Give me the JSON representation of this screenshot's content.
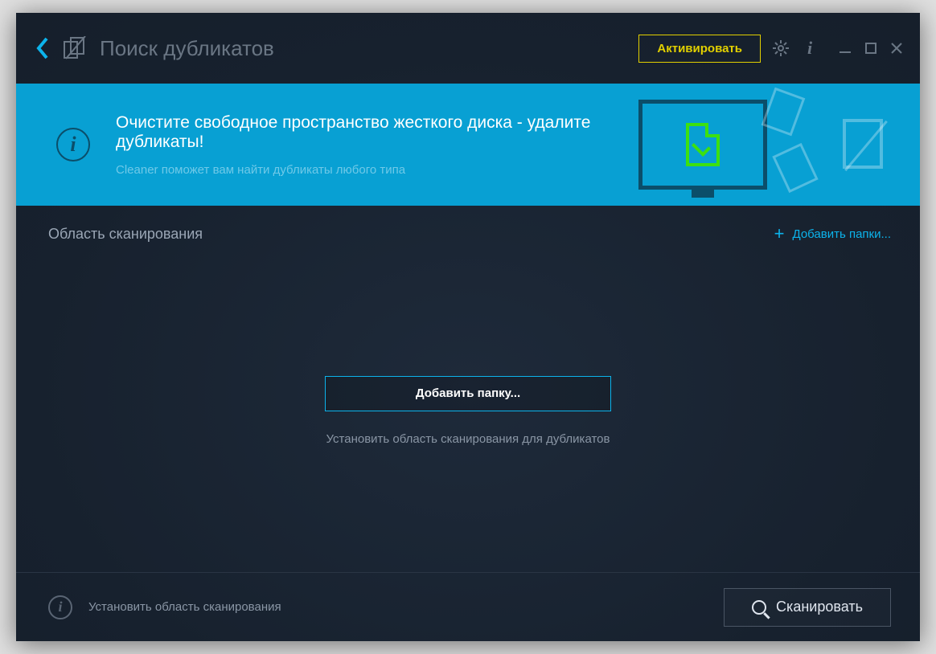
{
  "titlebar": {
    "title": "Поиск дубликатов",
    "activate_label": "Активировать"
  },
  "banner": {
    "heading": "Очистите свободное пространство жесткого диска - удалите дубликаты!",
    "subtitle": "Cleaner поможет вам найти дубликаты любого типа"
  },
  "scan_area": {
    "title": "Область сканирования",
    "add_folders_label": "Добавить папки..."
  },
  "content": {
    "add_folder_label": "Добавить папку...",
    "subtitle": "Установить область сканирования для дубликатов"
  },
  "footer": {
    "hint": "Установить область сканирования",
    "scan_label": "Сканировать"
  }
}
